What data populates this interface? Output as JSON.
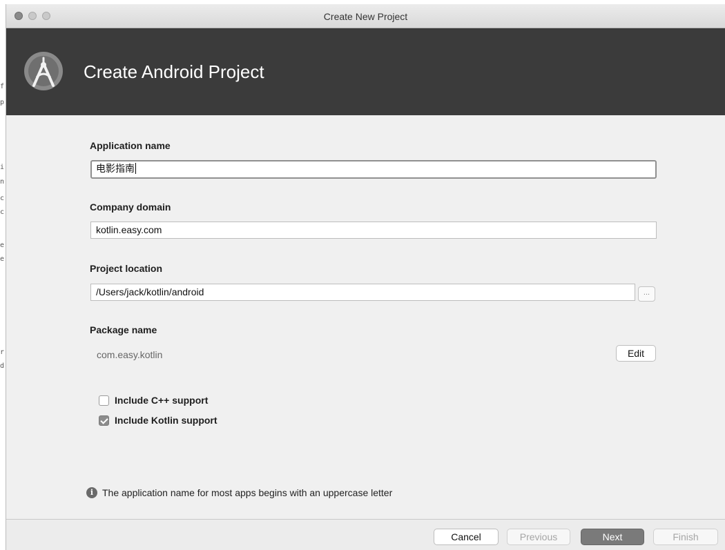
{
  "window": {
    "title": "Create New Project"
  },
  "header": {
    "title": "Create Android Project",
    "logo_icon": "android-studio-icon"
  },
  "form": {
    "app_name": {
      "label": "Application name",
      "value": "电影指南"
    },
    "company_domain": {
      "label": "Company domain",
      "value": "kotlin.easy.com"
    },
    "project_location": {
      "label": "Project location",
      "value": "/Users/jack/kotlin/android",
      "browse_label": "..."
    },
    "package_name": {
      "label": "Package name",
      "value": "com.easy.kotlin",
      "edit_label": "Edit"
    },
    "options": [
      {
        "label": "Include C++ support",
        "checked": false
      },
      {
        "label": "Include Kotlin support",
        "checked": true
      }
    ],
    "hint": "The application name for most apps begins with an uppercase letter"
  },
  "footer": {
    "cancel": "Cancel",
    "previous": "Previous",
    "next": "Next",
    "finish": "Finish"
  }
}
